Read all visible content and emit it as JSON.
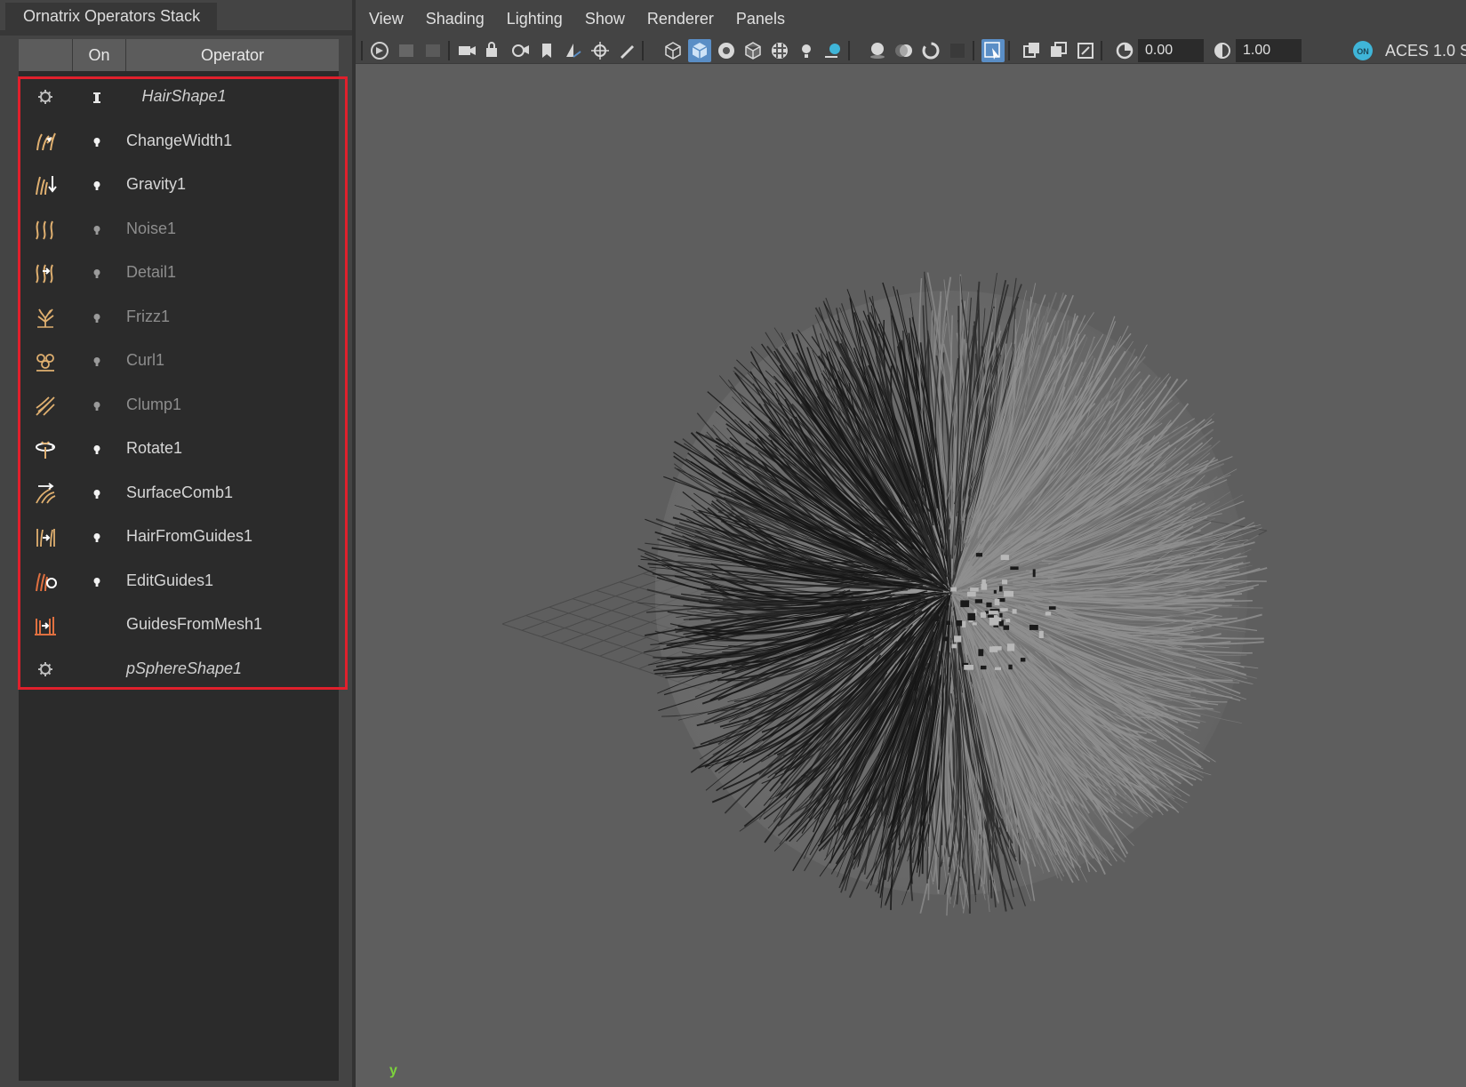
{
  "panel": {
    "title": "Ornatrix Operators Stack",
    "header": {
      "on_label": "On",
      "operator_label": "Operator"
    },
    "rows": [
      {
        "label": "HairShape1",
        "kind": "shape",
        "icon": "gear-icon",
        "on_marker": "bar"
      },
      {
        "label": "ChangeWidth1",
        "kind": "enabled",
        "icon": "change-width-icon",
        "on_marker": "bulb"
      },
      {
        "label": "Gravity1",
        "kind": "enabled",
        "icon": "gravity-icon",
        "on_marker": "bulb"
      },
      {
        "label": "Noise1",
        "kind": "disabled",
        "icon": "noise-icon",
        "on_marker": "bulb"
      },
      {
        "label": "Detail1",
        "kind": "disabled",
        "icon": "detail-icon",
        "on_marker": "bulb"
      },
      {
        "label": "Frizz1",
        "kind": "disabled",
        "icon": "frizz-icon",
        "on_marker": "bulb"
      },
      {
        "label": "Curl1",
        "kind": "disabled",
        "icon": "curl-icon",
        "on_marker": "bulb"
      },
      {
        "label": "Clump1",
        "kind": "disabled",
        "icon": "clump-icon",
        "on_marker": "bulb"
      },
      {
        "label": "Rotate1",
        "kind": "enabled",
        "icon": "rotate-icon",
        "on_marker": "bulb"
      },
      {
        "label": "SurfaceComb1",
        "kind": "enabled",
        "icon": "surface-comb-icon",
        "on_marker": "bulb"
      },
      {
        "label": "HairFromGuides1",
        "kind": "enabled",
        "icon": "hair-from-guides-icon",
        "on_marker": "bulb"
      },
      {
        "label": "EditGuides1",
        "kind": "enabled",
        "icon": "edit-guides-icon",
        "on_marker": "bulb"
      },
      {
        "label": "GuidesFromMesh1",
        "kind": "enabled",
        "icon": "guides-from-mesh-icon",
        "on_marker": "none"
      },
      {
        "label": "pSphereShape1",
        "kind": "shape",
        "icon": "gear-icon",
        "on_marker": "none"
      }
    ],
    "highlight_color": "#e0202c"
  },
  "viewport": {
    "menu": [
      "View",
      "Shading",
      "Lighting",
      "Show",
      "Renderer",
      "Panels"
    ],
    "exposure_value": "0.00",
    "gamma_value": "1.00",
    "color_management_badge": "ON",
    "color_space_label": "ACES 1.0 S",
    "axis_label": "y",
    "accent_color": "#5a8ec6"
  }
}
